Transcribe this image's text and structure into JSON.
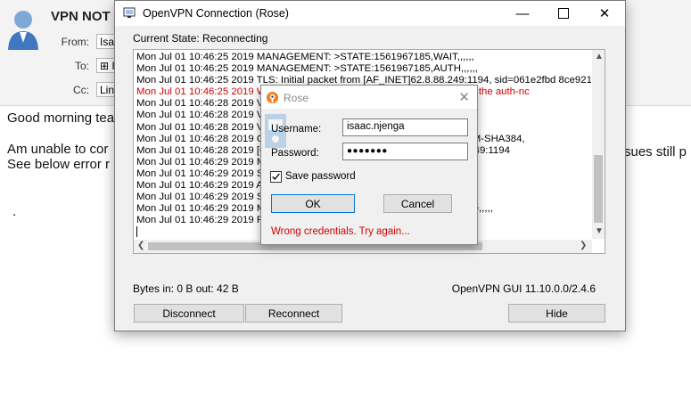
{
  "email": {
    "subject": "VPN NOT",
    "from_label": "From:",
    "from_value": "Isa",
    "to_label": "To:",
    "to_value": "⊞ I",
    "cc_label": "Cc:",
    "cc_value": "Lin",
    "body": {
      "greeting": "Good morning tea",
      "line1": "Am unable to cor",
      "line1_tail": "sues still p",
      "line2": "See below error r",
      "dot": "."
    }
  },
  "vpn_window": {
    "title": "OpenVPN Connection (Rose)",
    "current_state": "Current State: Reconnecting",
    "log": [
      {
        "text": "Mon Jul 01 10:46:25 2019 MANAGEMENT: >STATE:1561967185,WAIT,,,,,,",
        "warn": false
      },
      {
        "text": "Mon Jul 01 10:46:25 2019 MANAGEMENT: >STATE:1561967185,AUTH,,,,,,",
        "warn": false
      },
      {
        "text": "Mon Jul 01 10:46:25 2019 TLS: Initial packet from [AF_INET]62.8.88.249:1194, sid=061e2fbd 8ce92154",
        "warn": false
      },
      {
        "text": "Mon Jul 01 10:46:25 2019 WA                                              n memory -- use the auth-nc",
        "warn": true
      },
      {
        "text": "Mon Jul 01 10:46:28 2019 VE",
        "warn": false
      },
      {
        "text": "Mon Jul 01 10:46:28 2019 VE",
        "warn": false
      },
      {
        "text": "Mon Jul 01 10:46:28 2019 VE",
        "warn": false
      },
      {
        "text": "Mon Jul 01 10:46:28 2019 Co                                              SA-AES256-GCM-SHA384,",
        "warn": false
      },
      {
        "text": "Mon Jul 01 10:46:28 2019 [Op                                             _INET]62.8.88.249:1194",
        "warn": false
      },
      {
        "text": "Mon Jul 01 10:46:29 2019 MA                                              ,,,,,",
        "warn": false
      },
      {
        "text": "Mon Jul 01 10:46:29 2019 SE                                              EST' (status=1)",
        "warn": false
      },
      {
        "text": "Mon Jul 01 10:46:29 2019 AU",
        "warn": false
      },
      {
        "text": "Mon Jul 01 10:46:29 2019 SIG                                             g",
        "warn": false
      },
      {
        "text": "Mon Jul 01 10:46:29 2019 MA                                              TING,auth-failure,,,,,",
        "warn": false
      },
      {
        "text": "Mon Jul 01 10:46:29 2019 Re",
        "warn": false
      }
    ],
    "stats": "Bytes in: 0 B  out: 42 B",
    "version": "OpenVPN GUI 11.10.0.0/2.4.6",
    "buttons": {
      "disconnect": "Disconnect",
      "reconnect": "Reconnect",
      "hide": "Hide"
    }
  },
  "login_dialog": {
    "title": "Rose",
    "username_label": "Username:",
    "username_value": "isaac.njenga",
    "password_label": "Password:",
    "password_value": "●●●●●●●",
    "save_password_label": "Save password",
    "save_password_checked": true,
    "ok_label": "OK",
    "cancel_label": "Cancel",
    "error": "Wrong credentials. Try again..."
  },
  "colors": {
    "error_red": "#d40000",
    "log_warning_red": "#d00000",
    "openvpn_orange": "#f0821e"
  }
}
